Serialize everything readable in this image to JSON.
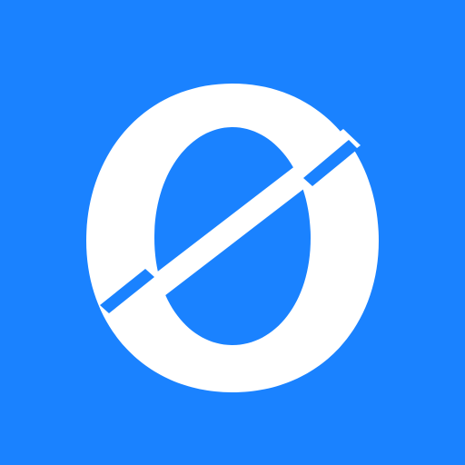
{
  "icon": {
    "name": "slashed-zero-logo-icon"
  },
  "colors": {
    "background": "#1A82FF",
    "foreground": "#FFFFFF"
  }
}
